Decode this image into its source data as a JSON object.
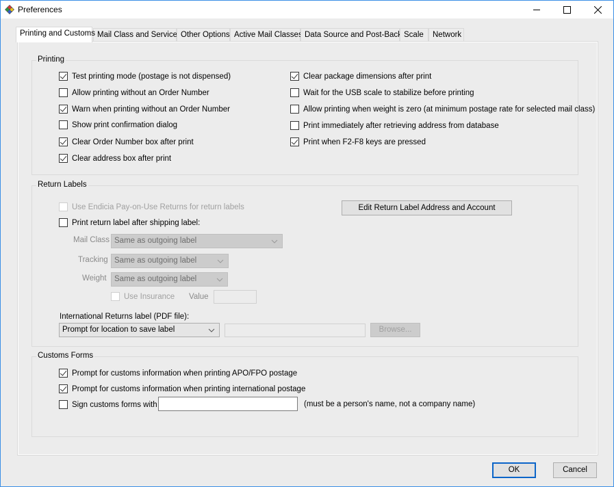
{
  "window": {
    "title": "Preferences",
    "app_icon": "diamond-app-icon",
    "controls": [
      "minimize",
      "maximize",
      "close"
    ]
  },
  "tabs": [
    {
      "label": "Printing and Customs",
      "active": true
    },
    {
      "label": "Mail Class and Services",
      "active": false
    },
    {
      "label": "Other Options",
      "active": false
    },
    {
      "label": "Active Mail Classes",
      "active": false
    },
    {
      "label": "Data Source and Post-Back",
      "active": false
    },
    {
      "label": "Scale",
      "active": false
    },
    {
      "label": "Network",
      "active": false
    }
  ],
  "printing": {
    "title": "Printing",
    "left": [
      {
        "label": "Test printing mode (postage is not dispensed)",
        "checked": true
      },
      {
        "label": "Allow printing without an Order Number",
        "checked": false
      },
      {
        "label": "Warn when printing without an Order Number",
        "checked": true
      },
      {
        "label": "Show print confirmation dialog",
        "checked": false
      },
      {
        "label": "Clear Order Number box after print",
        "checked": true
      },
      {
        "label": "Clear address box after print",
        "checked": true
      }
    ],
    "right": [
      {
        "label": "Clear package dimensions after print",
        "checked": true
      },
      {
        "label": "Wait for the USB scale to stabilize before printing",
        "checked": false
      },
      {
        "label": "Allow printing when weight is zero (at minimum postage rate for selected mail class)",
        "checked": false
      },
      {
        "label": "Print immediately after retrieving address from database",
        "checked": false
      },
      {
        "label": "Print when F2-F8 keys are pressed",
        "checked": true
      }
    ]
  },
  "return_labels": {
    "title": "Return Labels",
    "use_endicia": {
      "label": "Use Endicia Pay-on-Use Returns for return labels",
      "checked": false,
      "disabled": true
    },
    "print_return": {
      "label": "Print return label after shipping label:",
      "checked": false
    },
    "edit_button": "Edit Return Label Address and Account",
    "mail_class": {
      "label": "Mail Class",
      "value": "Same as outgoing label"
    },
    "tracking": {
      "label": "Tracking",
      "value": "Same as outgoing label"
    },
    "weight": {
      "label": "Weight",
      "value": "Same as outgoing label"
    },
    "use_insurance": {
      "label": "Use Insurance",
      "checked": false,
      "disabled": true
    },
    "value_label": "Value",
    "value_input": "",
    "intl_label": "International Returns label (PDF file):",
    "intl_select": "Prompt for location to save label",
    "intl_path": "",
    "browse_button": "Browse..."
  },
  "customs": {
    "title": "Customs Forms",
    "apo": {
      "label": "Prompt for customs information when printing APO/FPO postage",
      "checked": true
    },
    "intl": {
      "label": "Prompt for customs information when printing international postage",
      "checked": true
    },
    "sign": {
      "label": "Sign customs forms with",
      "checked": false
    },
    "sign_value": "",
    "sign_hint": "(must be a person's name, not a company name)"
  },
  "footer": {
    "ok": "OK",
    "cancel": "Cancel"
  }
}
